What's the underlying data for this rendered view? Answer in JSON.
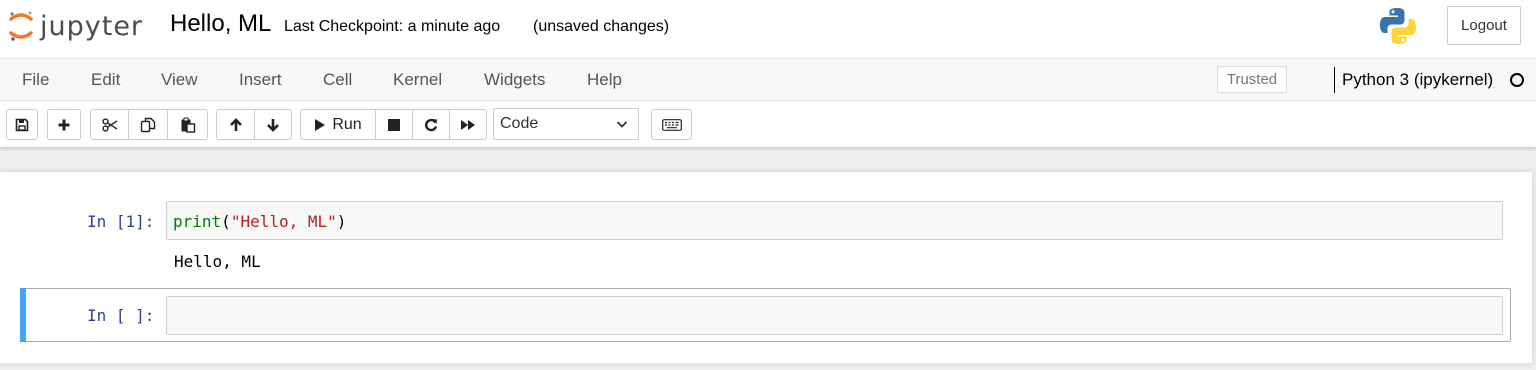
{
  "header": {
    "logo_text": "jupyter",
    "notebook_name": "Hello, ML",
    "checkpoint": "Last Checkpoint: a minute ago",
    "status": "(unsaved changes)",
    "logout_label": "Logout",
    "python_logo_icon": "python-logo-icon"
  },
  "menubar": {
    "items": [
      "File",
      "Edit",
      "View",
      "Insert",
      "Cell",
      "Kernel",
      "Widgets",
      "Help"
    ],
    "trusted_label": "Trusted",
    "kernel_name": "Python 3 (ipykernel)"
  },
  "toolbar": {
    "icons": [
      "save-icon",
      "plus-icon",
      "cut-icon",
      "copy-icon",
      "paste-icon",
      "arrow-up-icon",
      "arrow-down-icon",
      "play-icon",
      "stop-icon",
      "restart-icon",
      "fast-forward-icon",
      "keyboard-icon"
    ],
    "run_label": "Run",
    "cell_type": "Code"
  },
  "cells": [
    {
      "prompt": "In [1]:",
      "code_fn": "print",
      "code_open": "(",
      "code_string": "\"Hello, ML\"",
      "code_close": ")",
      "output": "Hello, ML"
    },
    {
      "prompt": "In [ ]:",
      "code": ""
    }
  ],
  "colors": {
    "selected_cell_bar": "#42a5f5",
    "prompt": "#303f9f",
    "keyword": "#008000",
    "string": "#ba2121",
    "logo_orange": "#f37726"
  }
}
